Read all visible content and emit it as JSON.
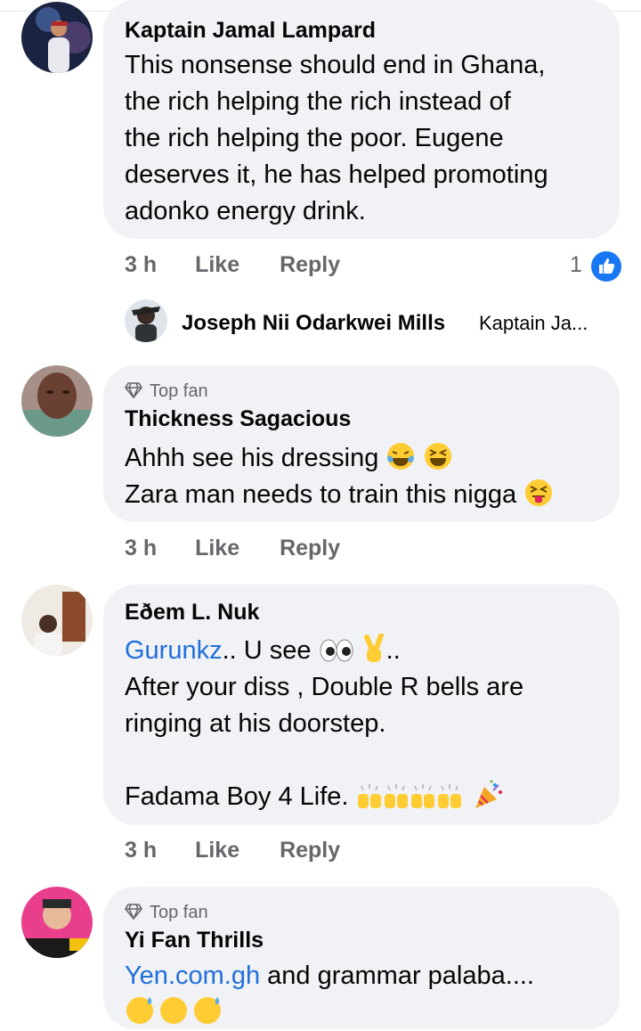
{
  "comments": [
    {
      "author": "Kaptain Jamal Lampard",
      "text_lines": [
        "This nonsense should end in Ghana,",
        "the rich helping the rich instead of",
        "the rich helping the poor. Eugene",
        "deserves it, he has helped promoting",
        "adonko energy drink."
      ],
      "time": "3 h",
      "like": "Like",
      "reply": "Reply",
      "reaction_count": "1",
      "reply_preview": {
        "author": "Joseph Nii Odarkwei Mills",
        "text": "Kaptain Ja..."
      }
    },
    {
      "badge": "Top fan",
      "author": "Thickness Sagacious",
      "line1": "Ahhh see his dressing",
      "line2": "Zara man needs to train this nigga",
      "time": "3 h",
      "like": "Like",
      "reply": "Reply"
    },
    {
      "author": "Eðem L. Nuk",
      "mention": "Gurunkz",
      "line1_rest": ".. U see",
      "line1_end": "..",
      "line2": "After your diss , Double R bells are",
      "line3": "ringing at his doorstep.",
      "line4": "Fadama Boy 4 Life.",
      "time": "3 h",
      "like": "Like",
      "reply": "Reply"
    },
    {
      "badge": "Top fan",
      "author": "Yi Fan Thrills",
      "mention": "Yen.com.gh",
      "rest": " and grammar palaba...."
    }
  ],
  "colors": {
    "bubble": "#f0f2f5",
    "secondary_text": "#65676b",
    "link": "#216fdb",
    "like_blue": "#1877f2"
  }
}
